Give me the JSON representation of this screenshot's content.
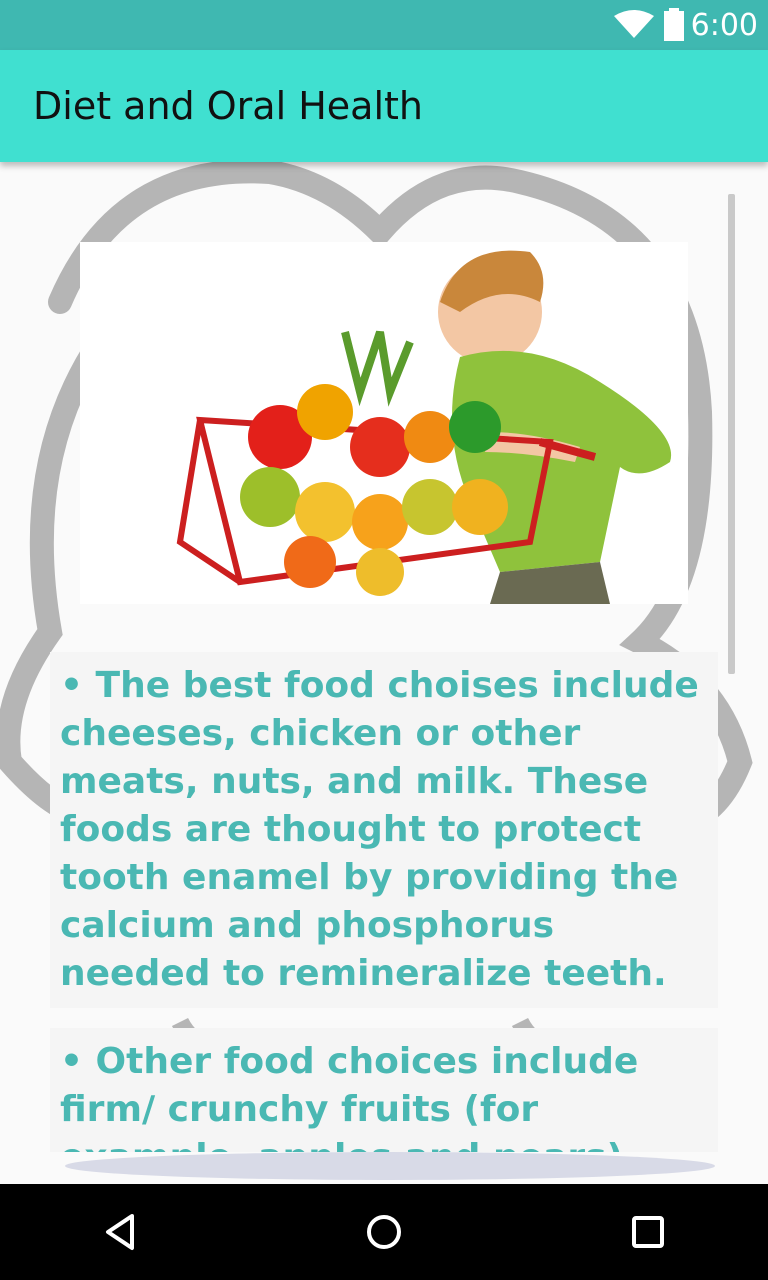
{
  "status_bar": {
    "time": "6:00",
    "icons": [
      "wifi-icon",
      "battery-icon"
    ]
  },
  "app_bar": {
    "title": "Diet and Oral Health"
  },
  "content": {
    "image_description_icon": "child-shopping-cart-vegetables",
    "paragraphs": [
      "• The best food choises include cheeses, chicken or other meats, nuts, and milk. These foods are thought to protect tooth enamel by providing the calcium and phosphorus needed to remineralize teeth.",
      "• Other food choices include firm/ crunchy fruits (for example, apples and pears) and vegetables. These"
    ]
  },
  "colors": {
    "status_bar": "#3fb8b1",
    "app_bar": "#40e0d0",
    "body_text": "#4ab8b3"
  },
  "nav_bar": {
    "buttons": [
      "back-icon",
      "home-icon",
      "recents-icon"
    ]
  }
}
